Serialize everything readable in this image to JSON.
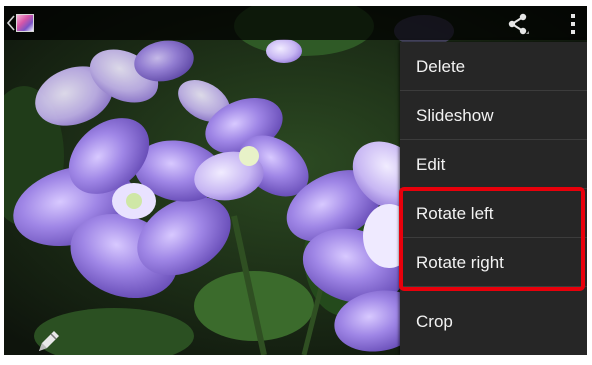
{
  "menu": {
    "items": [
      {
        "label": "Delete"
      },
      {
        "label": "Slideshow"
      },
      {
        "label": "Edit"
      },
      {
        "label": "Rotate left"
      },
      {
        "label": "Rotate right"
      },
      {
        "label": "Crop"
      }
    ]
  },
  "icons": {
    "up": "back-caret-icon",
    "app": "gallery-app-icon",
    "share": "share-icon",
    "overflow": "overflow-menu-icon",
    "edit": "pencil-icon"
  },
  "colors": {
    "menu_background": "#262626",
    "menu_text": "#f2f2f2",
    "highlight": "#e8000b",
    "flower_petal": "#9b84e0"
  }
}
